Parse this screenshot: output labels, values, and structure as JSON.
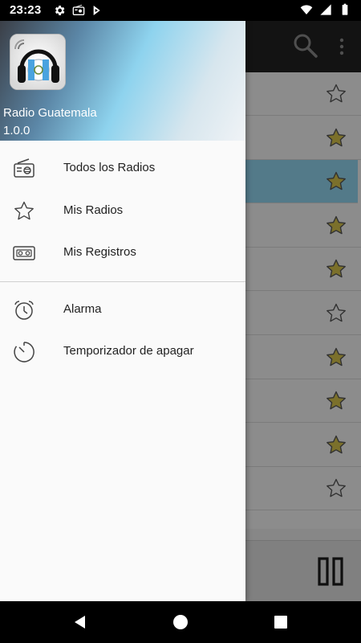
{
  "status_bar": {
    "time": "23:23",
    "left_icons": [
      "settings-icon",
      "radio-notification-icon",
      "play-store-icon"
    ],
    "right_icons": [
      "wifi-icon",
      "signal-icon",
      "battery-icon"
    ]
  },
  "toolbar": {
    "icons": [
      "search-icon",
      "overflow-menu-icon"
    ]
  },
  "station_list": {
    "favorite_states": [
      false,
      true,
      true,
      true,
      true,
      false,
      true,
      true,
      true,
      false
    ],
    "selected_index": 2
  },
  "player": {
    "control": "pause-icon"
  },
  "drawer": {
    "app_name": "Radio Guatemala",
    "version": "1.0.0",
    "items": [
      {
        "label": "Todos los Radios",
        "icon": "radio-icon"
      },
      {
        "label": "Mis Radios",
        "icon": "star-outline-icon"
      },
      {
        "label": "Mis Registros",
        "icon": "cassette-icon"
      },
      {
        "label": "Alarma",
        "icon": "alarm-clock-icon"
      },
      {
        "label": "Temporizador de apagar",
        "icon": "timer-icon"
      }
    ]
  },
  "colors": {
    "selected_row": "#8fd3ec",
    "star_filled": "#d4c24a",
    "drawer_bg": "#fafafa"
  }
}
